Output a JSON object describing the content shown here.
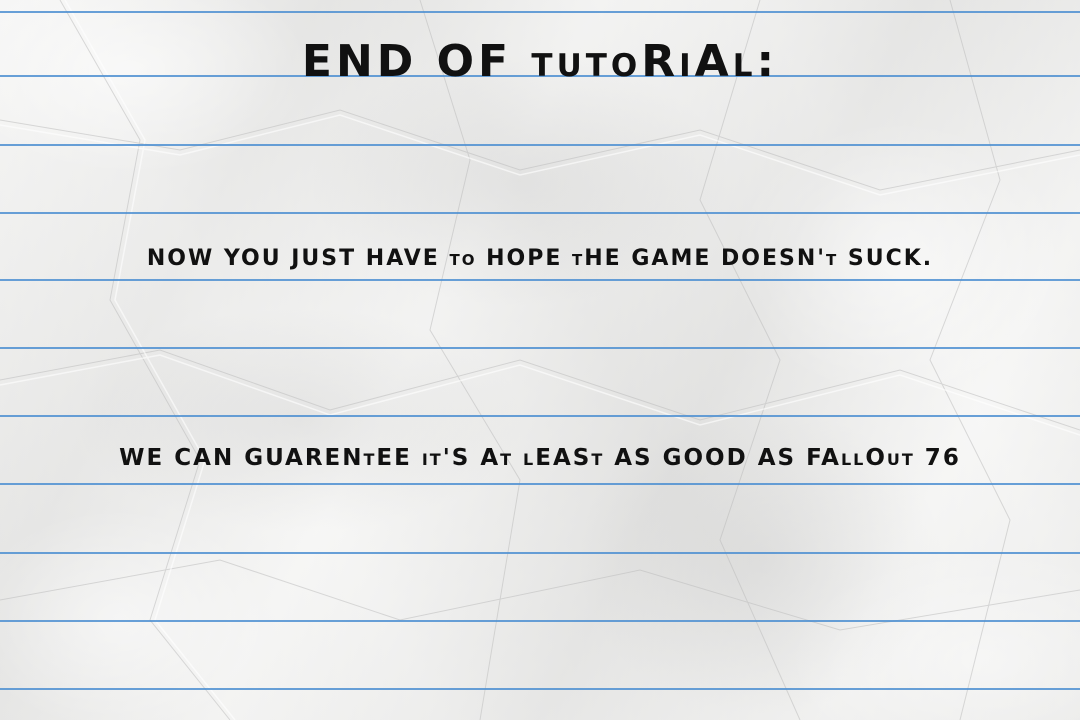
{
  "screen": {
    "title": "END OF tutoRiAl:",
    "line1": "NOW YOU JUST HAVE to HOPE tHE GAME DOESN't SUCK.",
    "line2": "WE CAN GUARENtEE it'S At lEASt AS GOOD AS FAllOut 76"
  },
  "colors": {
    "paper": "#eeeeec",
    "rule_line": "#4d8fd1",
    "ink": "#111111"
  }
}
